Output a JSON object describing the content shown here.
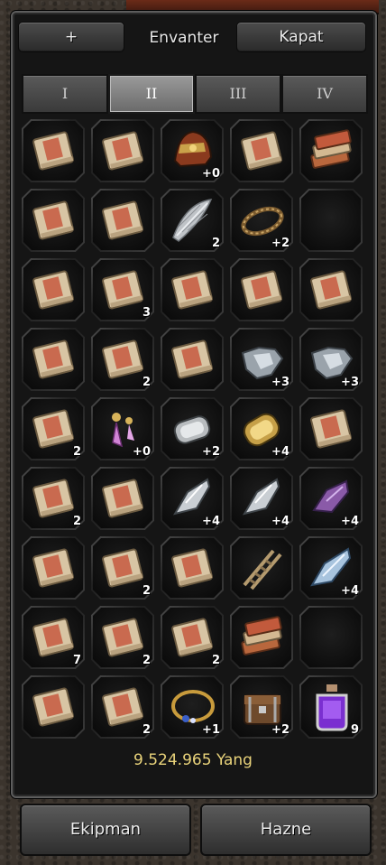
{
  "window": {
    "title": "Envanter",
    "add_label": "+",
    "close_label": "Kapat"
  },
  "tabs": [
    {
      "label": "I",
      "active": false
    },
    {
      "label": "II",
      "active": true
    },
    {
      "label": "III",
      "active": false
    },
    {
      "label": "IV",
      "active": false
    }
  ],
  "slots": [
    {
      "item": "book-icon",
      "count": ""
    },
    {
      "item": "book-icon",
      "count": ""
    },
    {
      "item": "helmet-icon",
      "count": "+0"
    },
    {
      "item": "book-icon",
      "count": ""
    },
    {
      "item": "book-stack-icon",
      "count": ""
    },
    {
      "item": "book-icon",
      "count": ""
    },
    {
      "item": "book-icon",
      "count": ""
    },
    {
      "item": "feather-icon",
      "count": "2"
    },
    {
      "item": "bracelet-icon",
      "count": "+2"
    },
    {
      "item": "empty",
      "count": ""
    },
    {
      "item": "book-icon",
      "count": ""
    },
    {
      "item": "book-icon",
      "count": "3"
    },
    {
      "item": "book-icon",
      "count": ""
    },
    {
      "item": "book-icon",
      "count": ""
    },
    {
      "item": "book-icon",
      "count": ""
    },
    {
      "item": "book-icon",
      "count": ""
    },
    {
      "item": "book-icon",
      "count": "2"
    },
    {
      "item": "book-icon",
      "count": ""
    },
    {
      "item": "armor-piece-icon",
      "count": "+3"
    },
    {
      "item": "armor-piece-icon",
      "count": "+3"
    },
    {
      "item": "book-icon",
      "count": "2"
    },
    {
      "item": "earring-icon",
      "count": "+0"
    },
    {
      "item": "armlet-icon",
      "count": "+2"
    },
    {
      "item": "gold-armlet-icon",
      "count": "+4"
    },
    {
      "item": "book-icon",
      "count": ""
    },
    {
      "item": "book-icon",
      "count": "2"
    },
    {
      "item": "book-icon",
      "count": ""
    },
    {
      "item": "crystal-icon",
      "count": "+4"
    },
    {
      "item": "crystal-icon",
      "count": "+4"
    },
    {
      "item": "purple-crystal-icon",
      "count": "+4"
    },
    {
      "item": "book-icon",
      "count": ""
    },
    {
      "item": "book-icon",
      "count": "2"
    },
    {
      "item": "book-icon",
      "count": ""
    },
    {
      "item": "ladder-icon",
      "count": ""
    },
    {
      "item": "blue-crystal-icon",
      "count": "+4"
    },
    {
      "item": "book-icon",
      "count": "7"
    },
    {
      "item": "book-icon",
      "count": "2"
    },
    {
      "item": "book-icon",
      "count": "2"
    },
    {
      "item": "book-stack-icon",
      "count": ""
    },
    {
      "item": "empty",
      "count": ""
    },
    {
      "item": "book-icon",
      "count": ""
    },
    {
      "item": "book-icon",
      "count": "2"
    },
    {
      "item": "necklace-icon",
      "count": "+1"
    },
    {
      "item": "chest-icon",
      "count": "+2"
    },
    {
      "item": "potion-icon",
      "count": "9"
    }
  ],
  "money": "9.524.965 Yang",
  "footer": {
    "equipment_label": "Ekipman",
    "storage_label": "Hazne"
  }
}
